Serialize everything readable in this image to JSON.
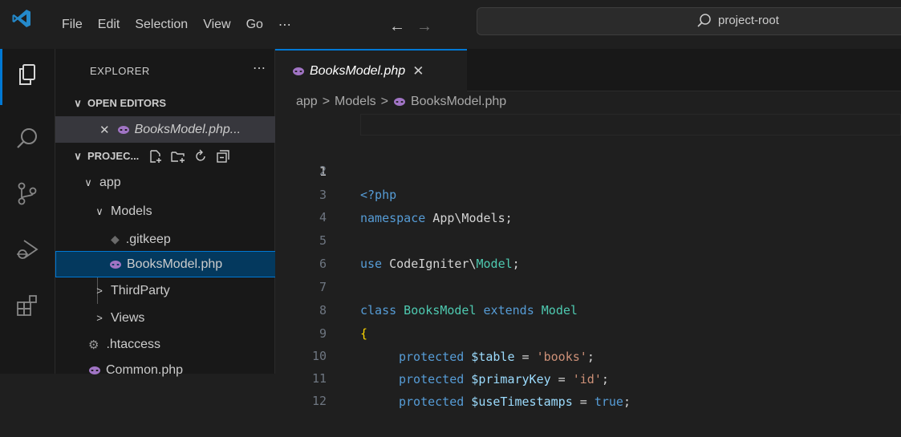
{
  "menu": [
    "File",
    "Edit",
    "Selection",
    "View",
    "Go",
    "⋯"
  ],
  "command_center": {
    "text": "project-root"
  },
  "sidebar": {
    "title": "EXPLORER",
    "more": "⋯",
    "open_editors_label": "OPEN EDITORS",
    "open_editor_file": "BooksModel.php...",
    "project_label": "PROJEC...",
    "tree": {
      "app": "app",
      "models": "Models",
      "gitkeep": ".gitkeep",
      "booksmodel": "BooksModel.php",
      "thirdparty": "ThirdParty",
      "views": "Views",
      "htaccess": ".htaccess",
      "common": "Common.php"
    }
  },
  "editor": {
    "tab_label": "BooksModel.php",
    "breadcrumb": [
      "app",
      "Models",
      "BooksModel.php"
    ],
    "code": {
      "l1": "<?php",
      "l3_kw": "namespace",
      "l3_rest": " App\\Models;",
      "l5_kw": "use",
      "l5_ns": " CodeIgniter\\",
      "l5_cls": "Model",
      "l5_end": ";",
      "l7_kw1": "class",
      "l7_cls1": " BooksModel",
      "l7_kw2": " extends",
      "l7_cls2": " Model",
      "l8": "{",
      "l9_kw": "protected",
      "l9_var": " $table",
      "l9_eq": " = ",
      "l9_str": "'books'",
      "l9_end": ";",
      "l10_kw": "protected",
      "l10_var": " $primaryKey",
      "l10_eq": " = ",
      "l10_str": "'id'",
      "l10_end": ";",
      "l11_kw": "protected",
      "l11_var": " $useTimestamps",
      "l11_eq": " = ",
      "l11_val": "true",
      "l11_end": ";"
    },
    "line_numbers": [
      "1",
      "2",
      "3",
      "4",
      "5",
      "6",
      "7",
      "8",
      "9",
      "10",
      "11",
      "12"
    ]
  },
  "colors": {
    "accent": "#0078d4",
    "php_icon": "#a074c4"
  }
}
